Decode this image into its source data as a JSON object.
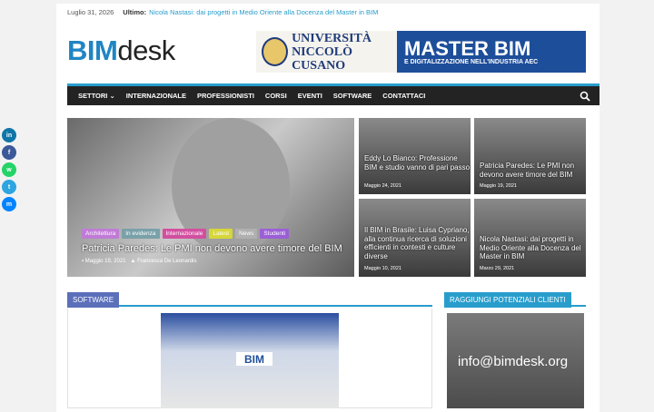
{
  "topbar": {
    "date": "Luglio 31, 2026",
    "label": "Ultimo:",
    "headline": "Nicola Nastasi: dai progetti in Medio Oriente alla Docenza del Master in BIM"
  },
  "logo": {
    "part1": "BIM",
    "part2": "desk"
  },
  "banner": {
    "uni_line1": "UNIVERSITÀ",
    "uni_line2": "NICCOLÒ CUSANO",
    "title": "MASTER BIM",
    "subtitle": "E DIGITALIZZAZIONE NELL'INDUSTRIA AEC"
  },
  "nav": {
    "items": [
      "SETTORI ⌄",
      "INTERNAZIONALE",
      "PROFESSIONISTI",
      "CORSI",
      "EVENTI",
      "SOFTWARE",
      "CONTATTACI"
    ]
  },
  "share": {
    "items": [
      "in",
      "f",
      "w",
      "t",
      "m"
    ]
  },
  "hero": {
    "categories": [
      "Architettura",
      "In evidenza",
      "Internazionale",
      "Latest",
      "News",
      "Studenti"
    ],
    "category_colors": [
      "#c07bd6",
      "#7aa0a8",
      "#d24fa0",
      "#d6d63a",
      "#b0b0b0",
      "#9b5fd6"
    ],
    "title": "Patricia Paredes: Le PMI non devono avere timore del BIM",
    "date": "Maggio 19, 2021",
    "author": "Francesca De Leonardis"
  },
  "tiles": [
    {
      "title": "Eddy Lo Bianco: Professione BIM e studio vanno di pari passo",
      "date": "Maggio 24, 2021"
    },
    {
      "title": "Patricia Paredes: Le PMI non devono avere timore del BIM",
      "date": "Maggio 19, 2021"
    },
    {
      "title": "Il BIM in Brasile: Luisa Cypriano, alla continua ricerca di soluzioni efficienti in contesti e culture diverse",
      "date": "Maggio 10, 2021"
    },
    {
      "title": "Nicola Nastasi: dai progetti in Medio Oriente alla Docenza del Master in BIM",
      "date": "Marzo 29, 2021"
    }
  ],
  "section": {
    "software": "SOFTWARE",
    "side": "RAGGIUNGI POTENZIALI CLIENTI"
  },
  "post_image_text": "BIM",
  "side_email": "info@bimdesk.org"
}
